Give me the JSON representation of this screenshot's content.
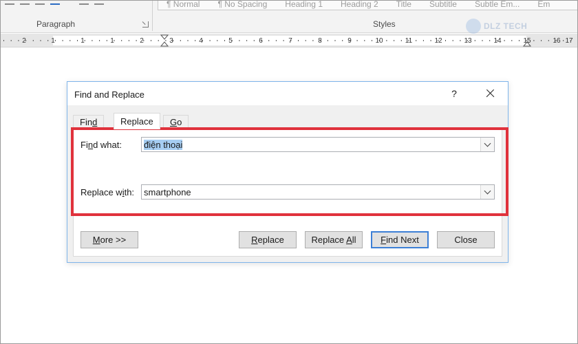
{
  "ribbon": {
    "paragraph_label": "Paragraph",
    "styles_label": "Styles",
    "styles_gallery": [
      "¶ Normal",
      "¶ No Spacing",
      "Heading 1",
      "Heading 2",
      "Title",
      "Subtitle",
      "Subtle Em...",
      "Em"
    ]
  },
  "watermark": {
    "text": "DLZ TECH"
  },
  "ruler": {
    "labels": [
      "2",
      "1",
      "1",
      "1",
      "2",
      "3",
      "4",
      "5",
      "6",
      "7",
      "8",
      "9",
      "10",
      "11",
      "12",
      "13",
      "14",
      "15",
      "16",
      "17"
    ]
  },
  "dialog": {
    "title": "Find and Replace",
    "help_label": "?",
    "tabs": [
      {
        "pre": "Fin",
        "u": "d",
        "post": ""
      },
      {
        "pre": "Re",
        "u": "p",
        "post": "lace"
      },
      {
        "pre": "",
        "u": "G",
        "post": "o To"
      }
    ],
    "find": {
      "label_pre": "Fi",
      "label_u": "n",
      "label_post": "d what:",
      "value": "điện thoại"
    },
    "replace": {
      "label_pre": "Replace w",
      "label_u": "i",
      "label_post": "th:",
      "value": "smartphone"
    },
    "buttons": {
      "more": {
        "pre": "",
        "u": "M",
        "post": "ore >>"
      },
      "replace": {
        "pre": "",
        "u": "R",
        "post": "eplace"
      },
      "replace_all": {
        "pre": "Replace ",
        "u": "A",
        "post": "ll"
      },
      "find_next": {
        "pre": "",
        "u": "F",
        "post": "ind Next"
      },
      "close": {
        "pre": "Close",
        "u": "",
        "post": ""
      }
    }
  },
  "colors": {
    "highlight_border": "#e0323c",
    "dialog_border": "#7eb4ea",
    "selection": "#a6cdf2",
    "default_button_border": "#3c7fd6"
  }
}
